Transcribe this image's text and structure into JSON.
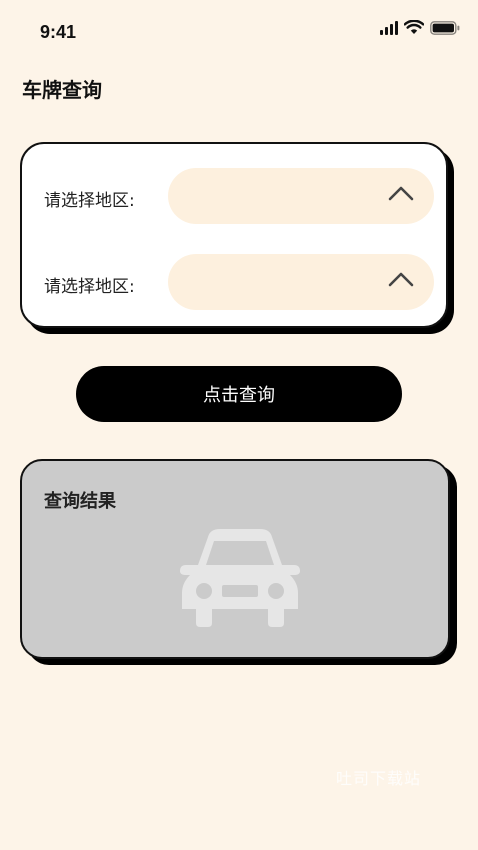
{
  "status_bar": {
    "time": "9:41",
    "icons": [
      "cellular-signal-icon",
      "wifi-icon",
      "battery-icon"
    ]
  },
  "page": {
    "title": "车牌查询"
  },
  "form": {
    "rows": [
      {
        "label": "请选择地区:",
        "value": "",
        "icon": "chevron-up-icon"
      },
      {
        "label": "请选择地区:",
        "value": "",
        "icon": "chevron-up-icon"
      }
    ]
  },
  "actions": {
    "query_label": "点击查询"
  },
  "result": {
    "title": "查询结果",
    "placeholder_icon": "car-icon"
  },
  "watermark": "吐司下载站",
  "colors": {
    "background": "#fdf4e8",
    "select_fill": "#fdf0de",
    "button": "#000000",
    "result_card": "#cbcbcb",
    "car_icon": "#e6e6e6"
  }
}
